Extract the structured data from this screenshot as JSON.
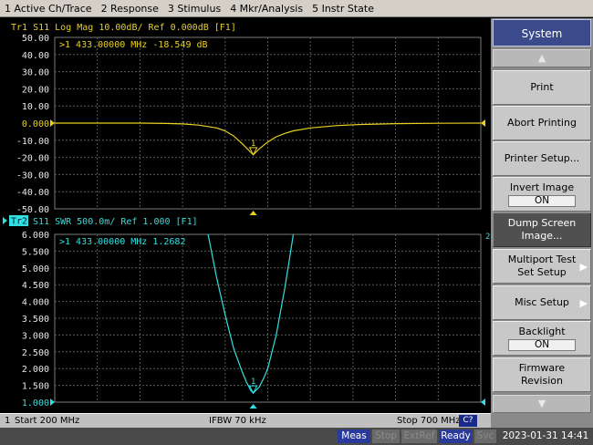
{
  "menu": [
    "1 Active Ch/Trace",
    "2 Response",
    "3 Stimulus",
    "4 Mkr/Analysis",
    "5 Instr State"
  ],
  "trace1": {
    "header": "Tr1  S11  Log Mag 10.00dB/ Ref 0.000dB [F1]",
    "marker_readout": ">1  433.00000 MHz  -18.549 dB",
    "y_labels": [
      "50.00",
      "40.00",
      "30.00",
      "20.00",
      "10.00",
      "0.000",
      "-10.00",
      "-20.00",
      "-30.00",
      "-40.00",
      "-50.00"
    ],
    "ref_label_index": 5,
    "color": "#e8d020",
    "marker_label": "1"
  },
  "trace2": {
    "badge": "Tr2",
    "header": "S11  SWR 500.0m/ Ref 1.000 [F1]",
    "marker_readout": ">1  433.00000 MHz  1.2682",
    "y_labels": [
      "6.000",
      "5.500",
      "5.000",
      "4.500",
      "4.000",
      "3.500",
      "3.000",
      "2.500",
      "2.000",
      "1.500",
      "1.000"
    ],
    "ref_label_index": 10,
    "color": "#30e0e0",
    "marker_label": "1",
    "right_tag": "2"
  },
  "chart_data": [
    {
      "type": "line",
      "title": "Tr1 S11 Log Mag 10.00dB/ Ref 0.000dB [F1]",
      "ylabel": "dB",
      "xlim": [
        200,
        700
      ],
      "ylim": [
        -50,
        50
      ],
      "grid": true,
      "series": [
        {
          "name": "S11",
          "x": [
            200,
            300,
            330,
            350,
            370,
            390,
            400,
            410,
            420,
            430,
            433,
            440,
            450,
            460,
            470,
            480,
            500,
            530,
            560,
            600,
            650,
            700
          ],
          "values": [
            0,
            0,
            -0.2,
            -0.5,
            -1.2,
            -2.8,
            -4.5,
            -7.5,
            -12,
            -17,
            -18.5,
            -15,
            -11,
            -8,
            -6,
            -4.5,
            -2.8,
            -1.5,
            -0.8,
            -0.3,
            -0.1,
            0
          ]
        }
      ],
      "marker": {
        "x": 433,
        "y": -18.549
      }
    },
    {
      "type": "line",
      "title": "S11 SWR 500.0m/ Ref 1.000 [F1]",
      "ylabel": "SWR",
      "xlim": [
        200,
        700
      ],
      "ylim": [
        1,
        6
      ],
      "grid": true,
      "series": [
        {
          "name": "S11",
          "x": [
            380,
            390,
            400,
            410,
            420,
            425,
            430,
            433,
            440,
            445,
            450,
            460,
            470,
            475,
            480
          ],
          "values": [
            6.0,
            4.7,
            3.6,
            2.6,
            1.9,
            1.6,
            1.35,
            1.27,
            1.45,
            1.7,
            2.0,
            3.0,
            4.4,
            5.2,
            6.0
          ]
        }
      ],
      "marker": {
        "x": 433,
        "y": 1.2682
      }
    }
  ],
  "channel_status": {
    "index": "1",
    "start": "Start 200 MHz",
    "ifbw": "IFBW 70 kHz",
    "stop": "Stop 700 MHz",
    "cal": "C?"
  },
  "instrument_status": {
    "items": [
      {
        "label": "Meas",
        "active": true
      },
      {
        "label": "Stop",
        "active": false
      },
      {
        "label": "ExtRef",
        "active": false
      },
      {
        "label": "Ready",
        "active": true
      },
      {
        "label": "Svc",
        "active": false
      }
    ],
    "datetime": "2023-01-31 14:41"
  },
  "softkeys": {
    "title": "System",
    "items": [
      {
        "label": "Print"
      },
      {
        "label": "Abort Printing"
      },
      {
        "label": "Printer Setup..."
      },
      {
        "label": "Invert Image",
        "value": "ON"
      },
      {
        "label": "Dump Screen Image...",
        "dark": true
      },
      {
        "label": "Multiport Test Set Setup",
        "submenu": true
      },
      {
        "label": "Misc Setup",
        "submenu": true
      },
      {
        "label": "Backlight",
        "value": "ON"
      },
      {
        "label": "Firmware Revision"
      }
    ],
    "up_arrow": "▲",
    "down_arrow": "▼",
    "submenu_glyph": "▶"
  }
}
